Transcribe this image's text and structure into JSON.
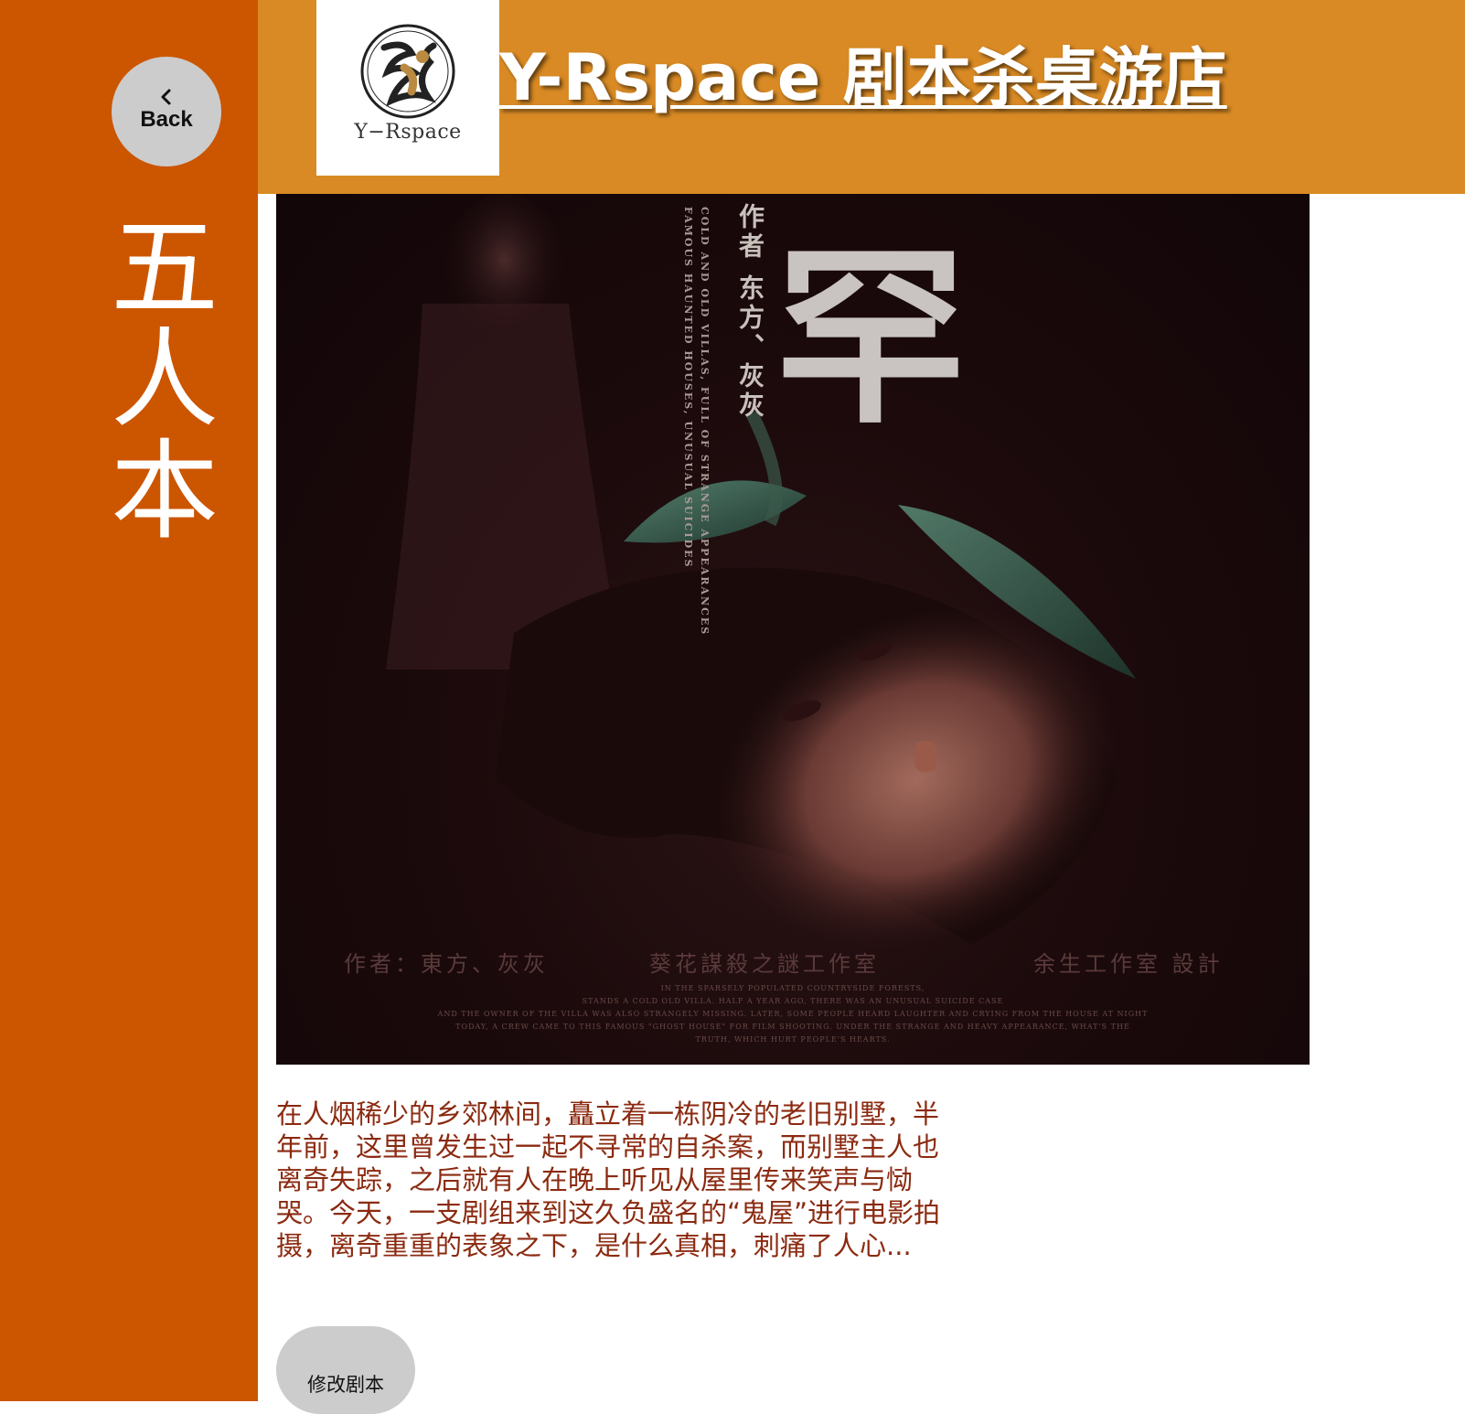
{
  "sidebar": {
    "back_label": "Back",
    "category_title": "五人本",
    "background": "#cc5500"
  },
  "header": {
    "logo_text": "Y−Rspace",
    "title": "Y-Rspace 剧本杀桌游店",
    "background": "#d98a24"
  },
  "poster": {
    "title_glyph": "罕",
    "vertical_author": "作者 东方、灰灰",
    "vertical_en_1": "COLD AND OLD VILLAS, FULL OF STRANGE APPEARANCES",
    "vertical_en_2": "FAMOUS HAUNTED HOUSES, UNUSUAL SUICIDES",
    "credit_author": "作者：東方、灰灰",
    "credit_studio": "葵花謀殺之謎工作室",
    "credit_design": "余生工作室 設計",
    "blurb_lines": [
      "IN THE SPARSELY POPULATED COUNTRYSIDE FORESTS,",
      "STANDS A COLD OLD VILLA. HALF A YEAR AGO, THERE WAS AN UNUSUAL SUICIDE CASE",
      "AND THE OWNER OF THE VILLA WAS ALSO STRANGELY MISSING. LATER, SOME PEOPLE HEARD LAUGHTER AND CRYING FROM THE HOUSE AT NIGHT",
      "TODAY, A CREW CAME TO THIS FAMOUS \"GHOST HOUSE\" FOR FILM SHOOTING. UNDER THE STRANGE AND HEAVY APPEARANCE, WHAT'S THE",
      "TRUTH, WHICH HURT PEOPLE'S HEARTS."
    ]
  },
  "script": {
    "description": "在人烟稀少的乡郊林间，矗立着一栋阴冷的老旧别墅，半年前，这里曾发生过一起不寻常的自杀案，而别墅主人也离奇失踪，之后就有人在晚上听见从屋里传来笑声与恸哭。今天，一支剧组来到这久负盛名的“鬼屋”进行电影拍摄，离奇重重的表象之下，是什么真相，刺痛了人心...",
    "text_color": "#8b2a10",
    "edit_button_label": "修改剧本"
  }
}
